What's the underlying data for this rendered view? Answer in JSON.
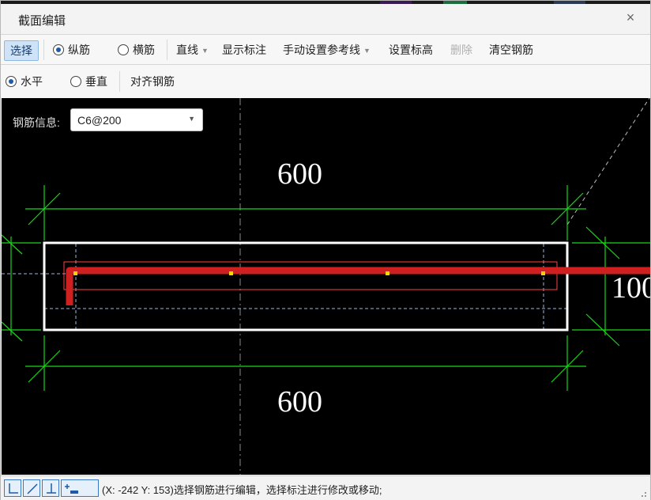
{
  "window": {
    "title": "截面编辑",
    "close_icon": "×"
  },
  "toolbar1": {
    "select_label": "选择",
    "radio_longitudinal": "纵筋",
    "radio_transverse": "横筋",
    "line_mode": "直线",
    "show_annotation": "显示标注",
    "manual_reference": "手动设置参考线",
    "set_elevation": "设置标高",
    "delete": "删除",
    "clear_rebar": "清空钢筋",
    "selected_radio": "纵筋"
  },
  "toolbar2": {
    "radio_horizontal": "水平",
    "radio_vertical": "垂直",
    "align_rebar": "对齐钢筋",
    "selected_radio": "水平"
  },
  "canvas": {
    "rebar_info_label": "钢筋信息:",
    "rebar_info_value": "C6@200",
    "dimensions": [
      "600",
      "600",
      "100"
    ]
  },
  "status": {
    "coordinates": "(X: -242 Y: 153)",
    "message": "选择钢筋进行编辑，选择标注进行修改或移动;"
  },
  "colors": {
    "dimension": "#19d619",
    "section": "#ffffff",
    "rebar": "#d01f1f",
    "highlight": "#ff4040",
    "point": "#ffd800",
    "accent": "#1f5aa8"
  }
}
